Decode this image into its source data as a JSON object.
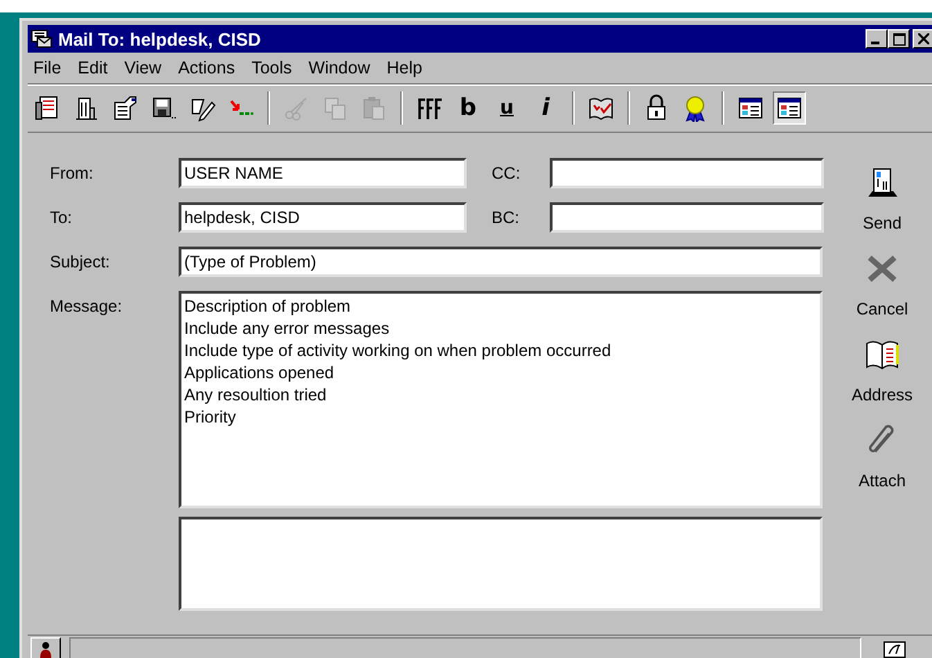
{
  "window": {
    "title": "Mail To: helpdesk, CISD"
  },
  "menu": [
    {
      "label": "File"
    },
    {
      "label": "Edit"
    },
    {
      "label": "View"
    },
    {
      "label": "Actions"
    },
    {
      "label": "Tools"
    },
    {
      "label": "Window"
    },
    {
      "label": "Help"
    }
  ],
  "toolbar": [
    {
      "kind": "memo",
      "disabled": false,
      "pressed": false
    },
    {
      "kind": "building",
      "disabled": false,
      "pressed": false
    },
    {
      "kind": "properties",
      "disabled": false,
      "pressed": false
    },
    {
      "kind": "save",
      "disabled": false,
      "pressed": false
    },
    {
      "kind": "spell",
      "disabled": false,
      "pressed": false
    },
    {
      "kind": "arrows",
      "disabled": false,
      "pressed": false
    },
    {
      "kind": "separator"
    },
    {
      "kind": "cut",
      "disabled": true,
      "pressed": false
    },
    {
      "kind": "copy",
      "disabled": true,
      "pressed": false
    },
    {
      "kind": "paste",
      "disabled": true,
      "pressed": false
    },
    {
      "kind": "separator"
    },
    {
      "kind": "font",
      "disabled": false,
      "pressed": false
    },
    {
      "kind": "bold",
      "glyph": "b",
      "disabled": false,
      "pressed": false
    },
    {
      "kind": "underline",
      "glyph": "u",
      "disabled": false,
      "pressed": false
    },
    {
      "kind": "italic",
      "glyph": "i",
      "disabled": false,
      "pressed": false
    },
    {
      "kind": "separator"
    },
    {
      "kind": "book-check",
      "disabled": false,
      "pressed": false
    },
    {
      "kind": "separator"
    },
    {
      "kind": "lock",
      "disabled": false,
      "pressed": false
    },
    {
      "kind": "ribbon",
      "disabled": false,
      "pressed": false
    },
    {
      "kind": "separator"
    },
    {
      "kind": "layout",
      "disabled": false,
      "pressed": false
    },
    {
      "kind": "layout-alt",
      "disabled": false,
      "pressed": true
    }
  ],
  "form": {
    "from": {
      "label": "From:",
      "value": "USER NAME"
    },
    "cc": {
      "label": "CC:"
    },
    "to": {
      "label": "To:",
      "value": "helpdesk, CISD"
    },
    "bc": {
      "label": "BC:"
    },
    "subject": {
      "label": "Subject:",
      "value": "(Type of Problem)"
    },
    "message": {
      "label": "Message:",
      "lines": [
        "Description of problem",
        "Include any error messages",
        "Include type of activity working on when problem occurred",
        "Applications opened",
        "Any resoultion tried",
        "Priority"
      ]
    }
  },
  "actions": [
    {
      "kind": "send",
      "label": "Send"
    },
    {
      "kind": "cancel",
      "label": "Cancel"
    },
    {
      "kind": "address",
      "label": "Address"
    },
    {
      "kind": "attach",
      "label": "Attach"
    }
  ]
}
